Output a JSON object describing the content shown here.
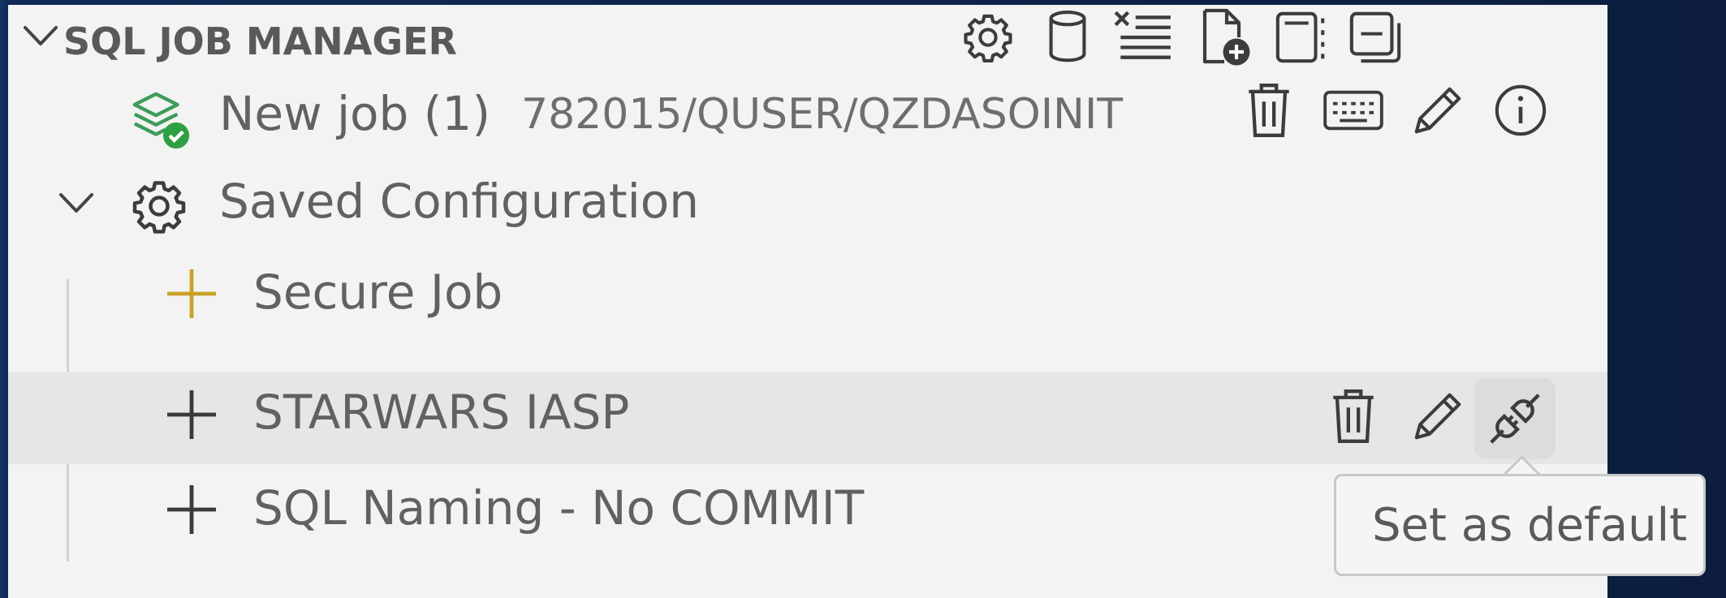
{
  "section": {
    "title": "SQL JOB MANAGER",
    "toolbar_icons": [
      "gear-icon",
      "database-icon",
      "clear-all-icon",
      "new-file-icon",
      "notebook-icon",
      "collapse-all-icon"
    ]
  },
  "job": {
    "label": "New job (1)",
    "description": "782015/QUSER/QZDASOINIT",
    "status_color": "#2ea043",
    "icon_color": "#3f9b5a",
    "actions": [
      "trash-icon",
      "keyboard-icon",
      "pencil-icon",
      "info-icon"
    ]
  },
  "saved_config": {
    "label": "Saved Configuration",
    "items": [
      {
        "label": "Secure Job",
        "icon_color": "#c9a227"
      },
      {
        "label": "STARWARS IASP",
        "icon_color": "#3a3a3a",
        "actions": [
          "trash-icon",
          "pencil-icon",
          "plug-icon"
        ]
      },
      {
        "label": "SQL Naming - No COMMIT",
        "icon_color": "#3a3a3a"
      }
    ]
  },
  "tooltip": {
    "text": "Set as default"
  }
}
